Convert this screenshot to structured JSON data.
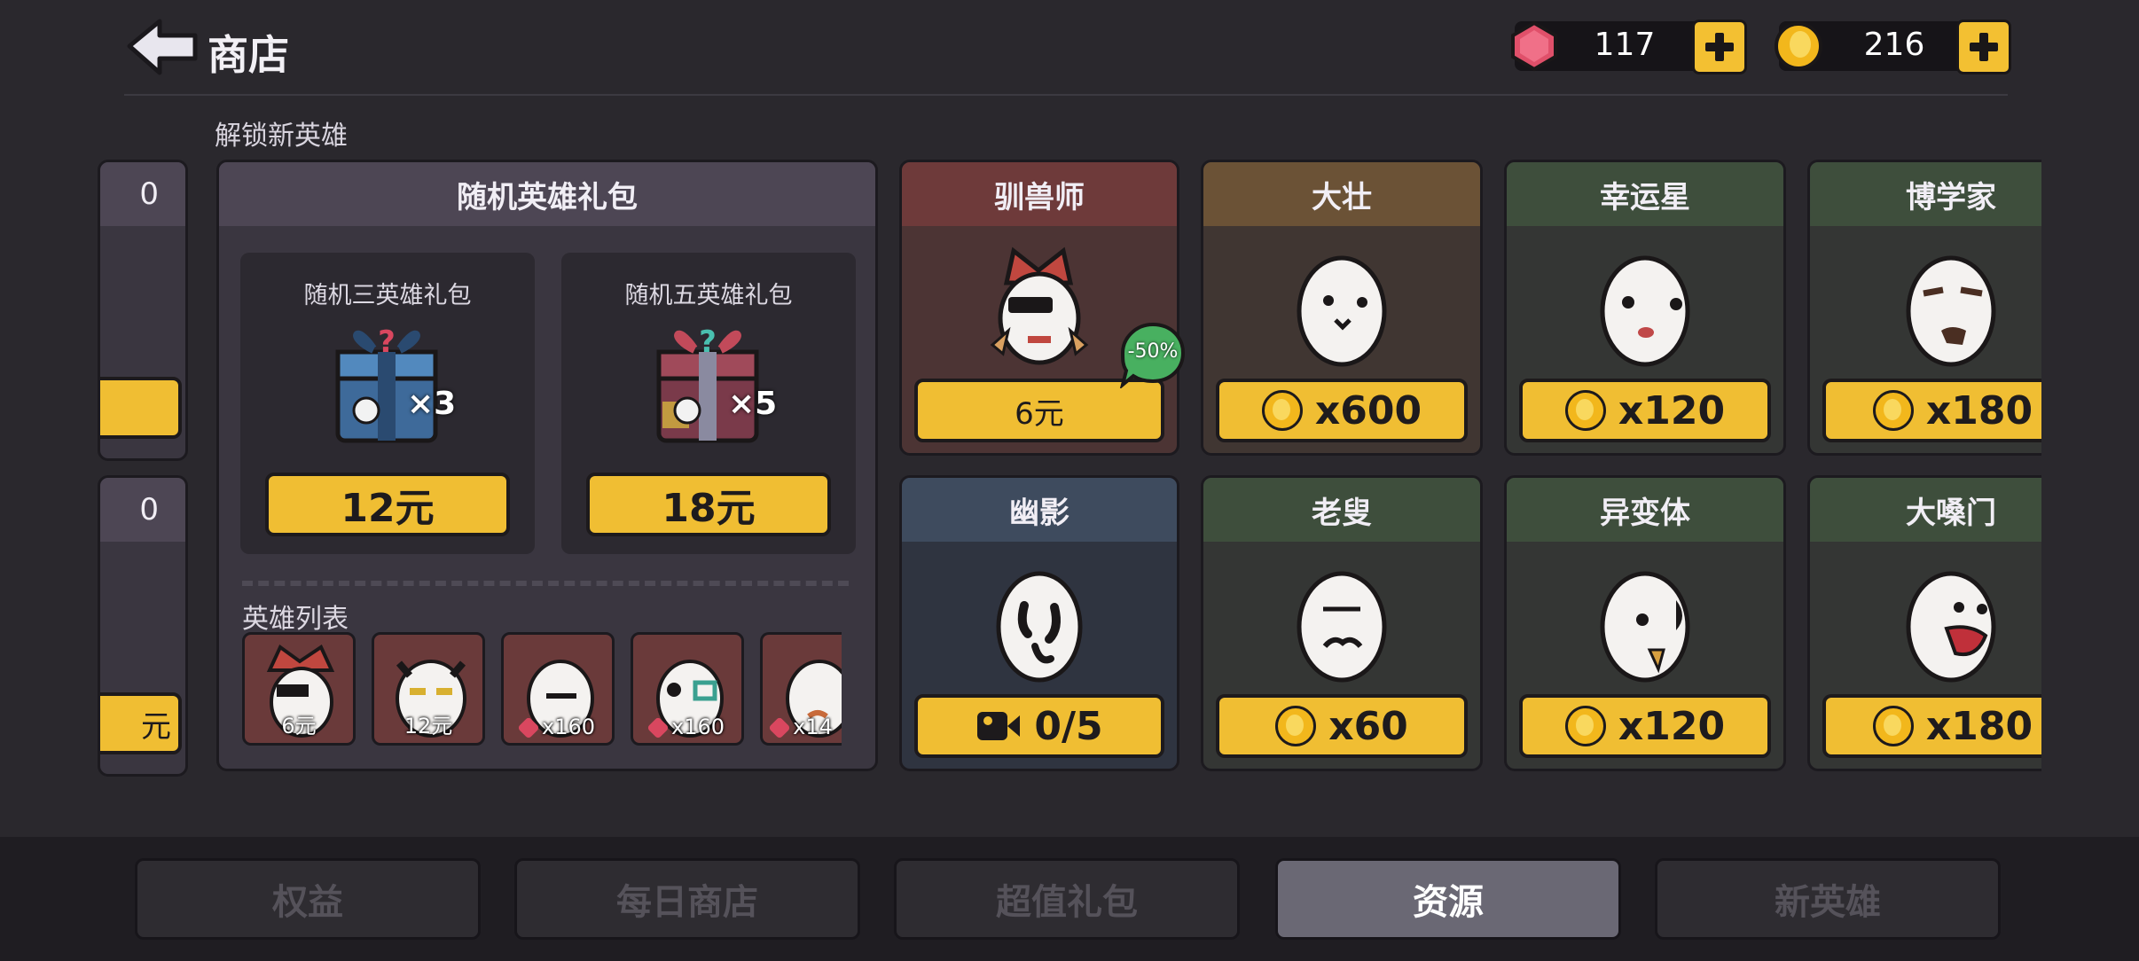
{
  "header": {
    "title": "商店",
    "gems": "117",
    "coins": "216"
  },
  "section_label": "解锁新英雄",
  "left_edge": {
    "top_suffix": "0",
    "bottom_suffix": "0",
    "bottom_btn": "元"
  },
  "gift_panel": {
    "title": "随机英雄礼包",
    "packs": [
      {
        "title": "随机三英雄礼包",
        "badge": "×3",
        "price": "12元"
      },
      {
        "title": "随机五英雄礼包",
        "badge": "×5",
        "price": "18元"
      }
    ],
    "hero_list_label": "英雄列表",
    "hero_list": [
      {
        "caption": "6元"
      },
      {
        "caption": "12元"
      },
      {
        "caption": "x160"
      },
      {
        "caption": "x160"
      },
      {
        "caption": "x14"
      }
    ]
  },
  "heroes": [
    {
      "name": "驯兽师",
      "price": "6元",
      "discount": "-50%",
      "color": "#6e3a3a"
    },
    {
      "name": "大壮",
      "price": "x600",
      "color": "#6b5236"
    },
    {
      "name": "幸运星",
      "price": "x120",
      "color": "#3e4e3c"
    },
    {
      "name": "博学家",
      "price": "x180",
      "color": "#3e4e3c"
    },
    {
      "name": "幽影",
      "price": "0/5",
      "color": "#3e4b5e"
    },
    {
      "name": "老叟",
      "price": "x60",
      "color": "#3e4e3c"
    },
    {
      "name": "异变体",
      "price": "x120",
      "color": "#3e4e3c"
    },
    {
      "name": "大嗓门",
      "price": "x180",
      "color": "#3e4e3c"
    }
  ],
  "tabs": [
    "权益",
    "每日商店",
    "超值礼包",
    "资源",
    "新英雄"
  ],
  "active_tab": "资源",
  "icons": [
    "back-arrow-icon",
    "gem-icon",
    "coin-icon",
    "plus-icon",
    "video-icon",
    "gift-box-icon"
  ]
}
